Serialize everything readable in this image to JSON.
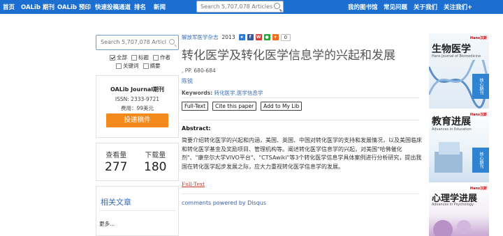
{
  "nav": {
    "items": [
      "首页",
      "OALib 期刊",
      "OALib 预印",
      "快速投稿通道",
      "排名",
      "新闻"
    ],
    "search_placeholder": "Search 5,707,078 Articles",
    "right_items": [
      "我的图书馆",
      "常见问题",
      "关于我们",
      "关注我们+"
    ]
  },
  "sidebar": {
    "search_placeholder": "Search 5,707,078 Articles",
    "filters": {
      "all": "全部",
      "title": "标题",
      "author": "作者",
      "keyword": "关键词",
      "abstract": "摘要"
    },
    "journal": {
      "title": "OALib Journal期刊",
      "issn": "ISSN: 2333-9721",
      "fee": "费用：99美元",
      "submit": "投递稿件"
    },
    "stats": {
      "views_label": "查看量",
      "views": "277",
      "downloads_label": "下载量",
      "downloads": "180"
    },
    "related": {
      "title": "相关文章",
      "more": "更多..."
    }
  },
  "article": {
    "journal": "解放军医学杂志",
    "year": "2013",
    "share_count": "0",
    "title": "转化医学及转化医学信息学的兴起和发展",
    "pages": ", PP. 680-684",
    "author": "陈锐",
    "keywords_label": "Keywords:",
    "keywords": "转化医学,医学信息学",
    "buttons": [
      "Full-Text",
      "Cite this paper",
      "Add to My Lib"
    ],
    "abstract_label": "Abstract:",
    "abstract": "简要介绍转化医学的兴起和内涵，美国、英国、中国对转化医学的支持和发展情况，以及美国临床和转化医学基金及奖励项目、管理机构等。阐述转化医学信息学的兴起，对美国\"哈佛催化剂\"、\"康奈尔大学VIVO平台\"、\"CTSAwiki\"等3个转化医学信息学具体案例进行分析研究，提出我国在转化医学起步发展之际，应大力重视转化医学信息学的发展。",
    "fulltext_link": "Full-Text",
    "disqus": "comments powered by Disqus"
  },
  "covers": [
    {
      "title": "生物医学",
      "subtitle": "Hans Journal of Biomedicine",
      "tag": "Hans汉斯",
      "badge": "核心期刊"
    },
    {
      "title": "教育进展",
      "subtitle": "Advances in Education",
      "tag": "Hans汉斯",
      "badge": "核心期刊"
    },
    {
      "title": "心理学进展",
      "subtitle": "Advances in Psychology",
      "tag": "Hans汉斯",
      "badge": ""
    }
  ],
  "colors": {
    "nav_bg": "#1c6fd0",
    "link": "#3a6db5",
    "submit_bg": "#f48a1c",
    "fulltext_link": "#c0392b"
  }
}
